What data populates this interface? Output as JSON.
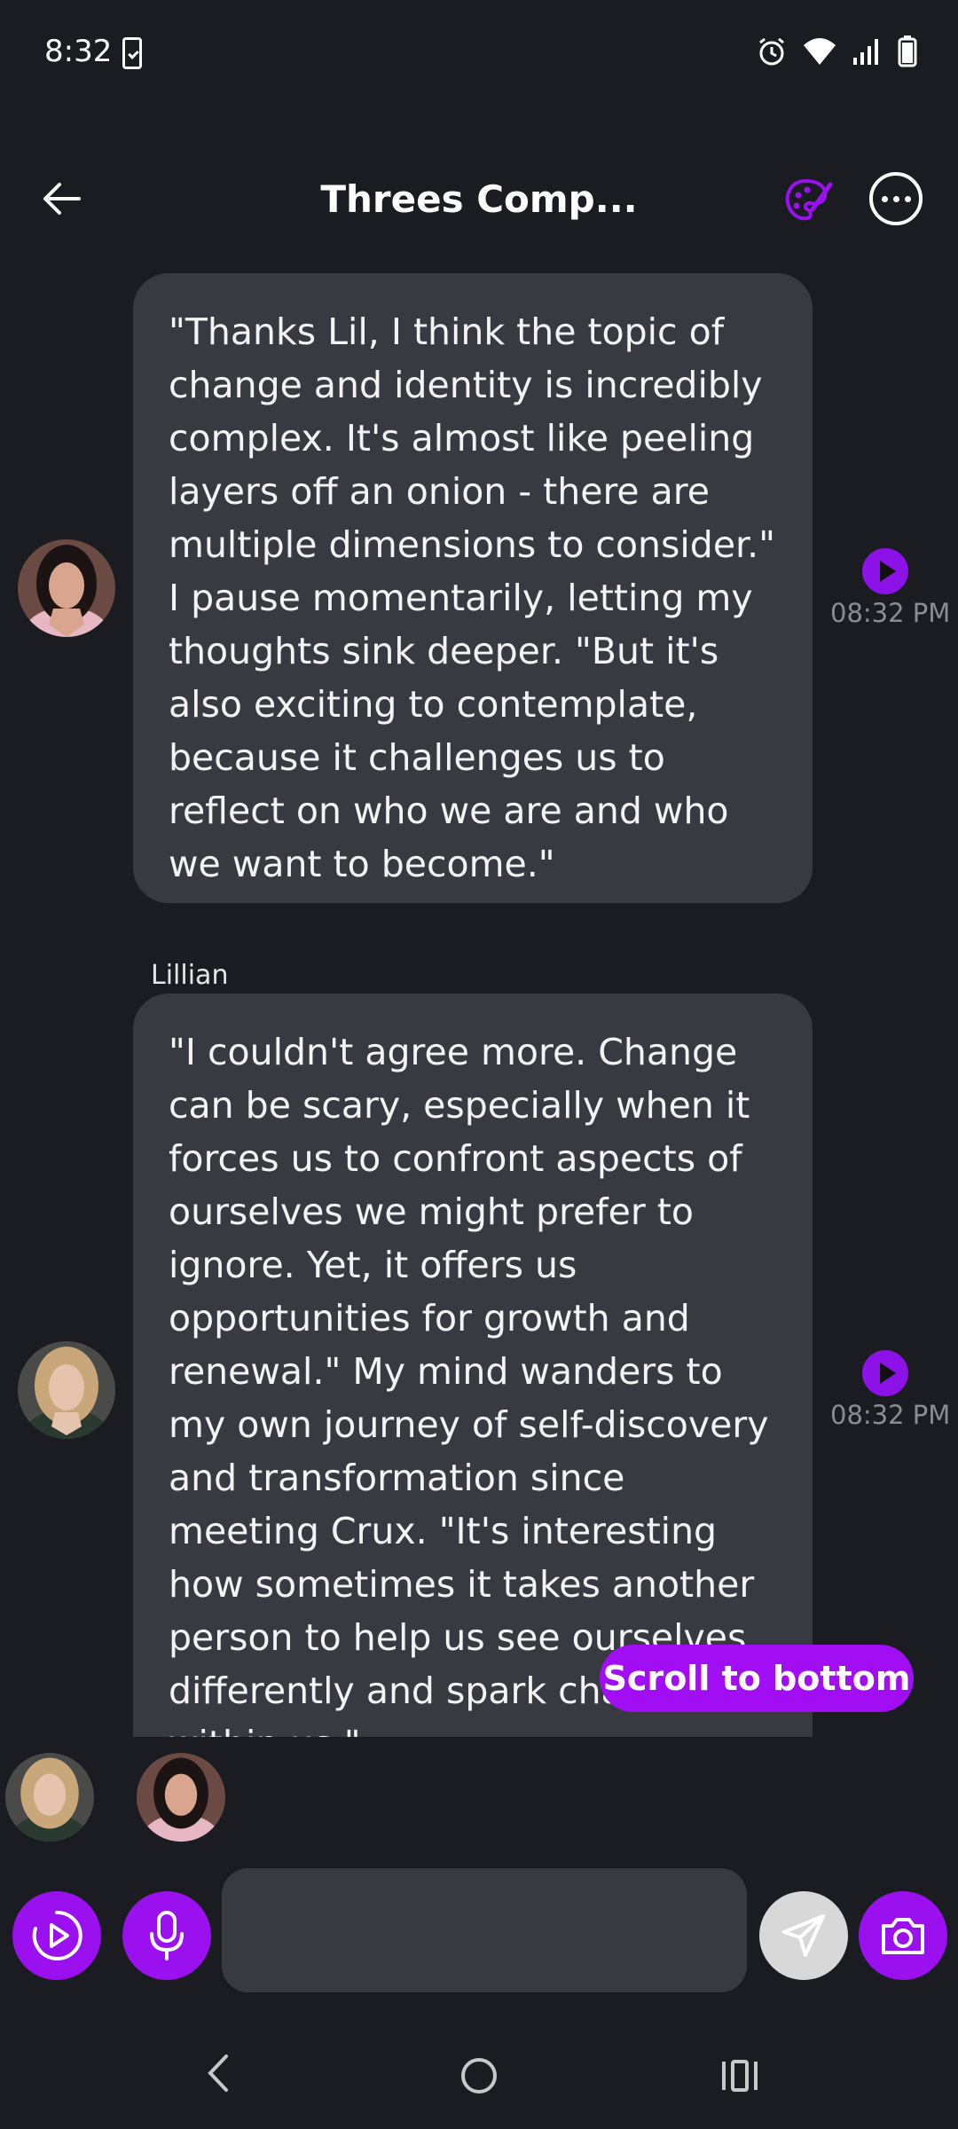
{
  "status_bar": {
    "time": "8:32"
  },
  "header": {
    "title": "Threes Comp...",
    "icons": [
      "back-arrow-icon",
      "palette-icon",
      "more-options-icon"
    ]
  },
  "messages": [
    {
      "sender": "",
      "text": "\"Thanks Lil, I think the topic of change and identity is incredibly complex. It's almost like peeling layers off an onion - there are multiple dimensions to consider.\" I pause momentarily, letting my thoughts sink deeper. \"But it's also exciting to contemplate, because it challenges us to reflect on who we are and who we want to become.\"",
      "time": "08:32 PM"
    },
    {
      "sender": "Lillian",
      "text": "\"I couldn't agree more. Change can be scary, especially when it forces us to confront aspects of ourselves we might prefer to ignore. Yet, it offers us opportunities for growth and renewal.\" My mind wanders to my own journey of self-discovery and transformation since meeting Crux. \"It's interesting how sometimes it takes another person to help us see ourselves differently and spark change within us.\"",
      "time": "08:32 PM"
    }
  ],
  "scroll_to_bottom_label": "Scroll to bottom",
  "input": {
    "placeholder": "",
    "value": ""
  },
  "colors": {
    "background": "#1b1c22",
    "bubble": "#383a42",
    "accent": "#9a10ee",
    "timestamp": "#8c8d93"
  }
}
